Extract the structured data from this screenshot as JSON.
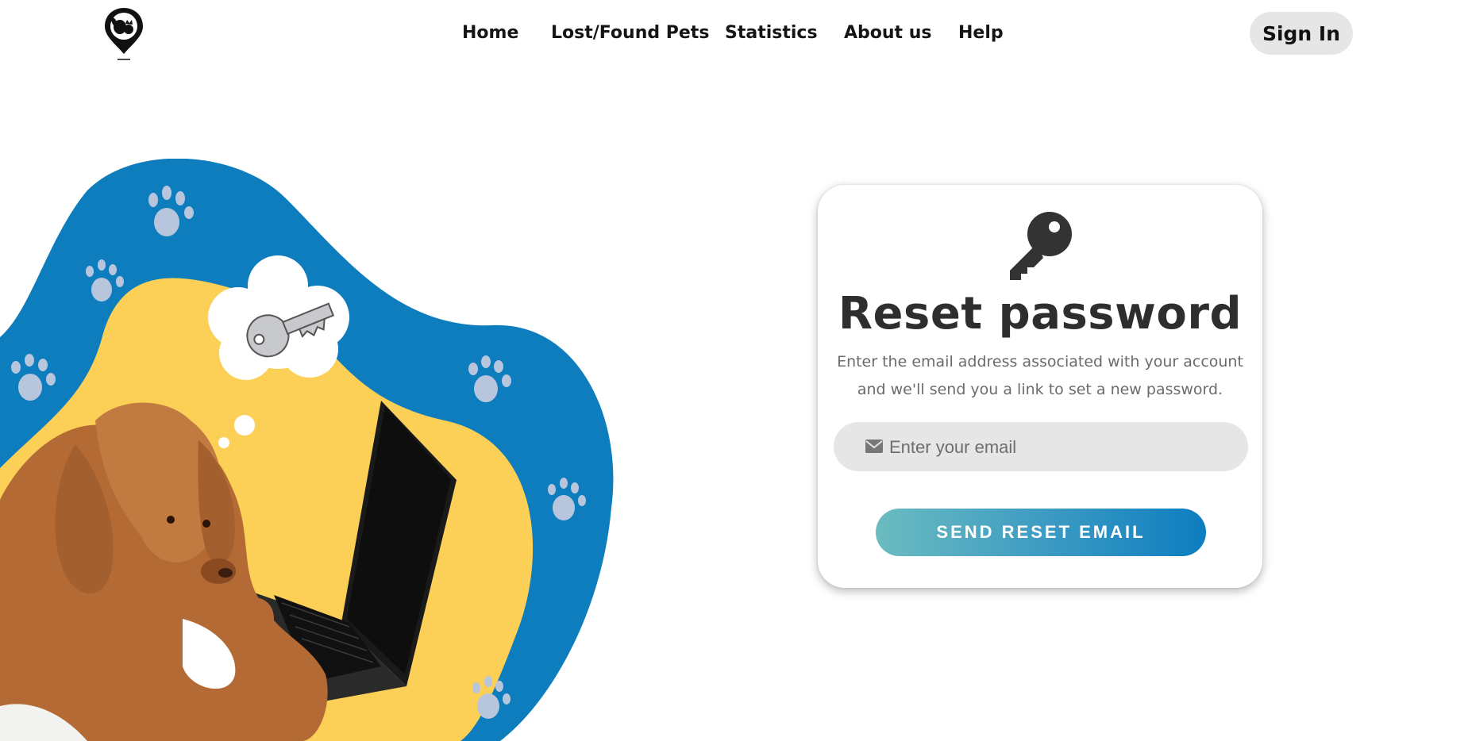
{
  "header": {
    "logo_name": "paw-pin-logo",
    "nav": [
      {
        "label": "Home"
      },
      {
        "label": "Lost/Found Pets"
      },
      {
        "label": "Statistics"
      },
      {
        "label": "About us"
      },
      {
        "label": "Help"
      }
    ],
    "signin_label": "Sign In"
  },
  "reset": {
    "icon": "key-icon",
    "title": "Reset password",
    "description": "Enter the email address associated with your account and we'll send you a link to set a new password.",
    "email_placeholder": "Enter your email",
    "email_value": "",
    "send_label": "SEND RESET EMAIL"
  },
  "colors": {
    "blob_blue": "#0d7dbd",
    "blob_yellow": "#fccf57",
    "paw": "#b7c6dd",
    "button_gradient_start": "#6bbcc0",
    "button_gradient_end": "#0c7dc0",
    "input_bg": "#e6e6e6"
  }
}
